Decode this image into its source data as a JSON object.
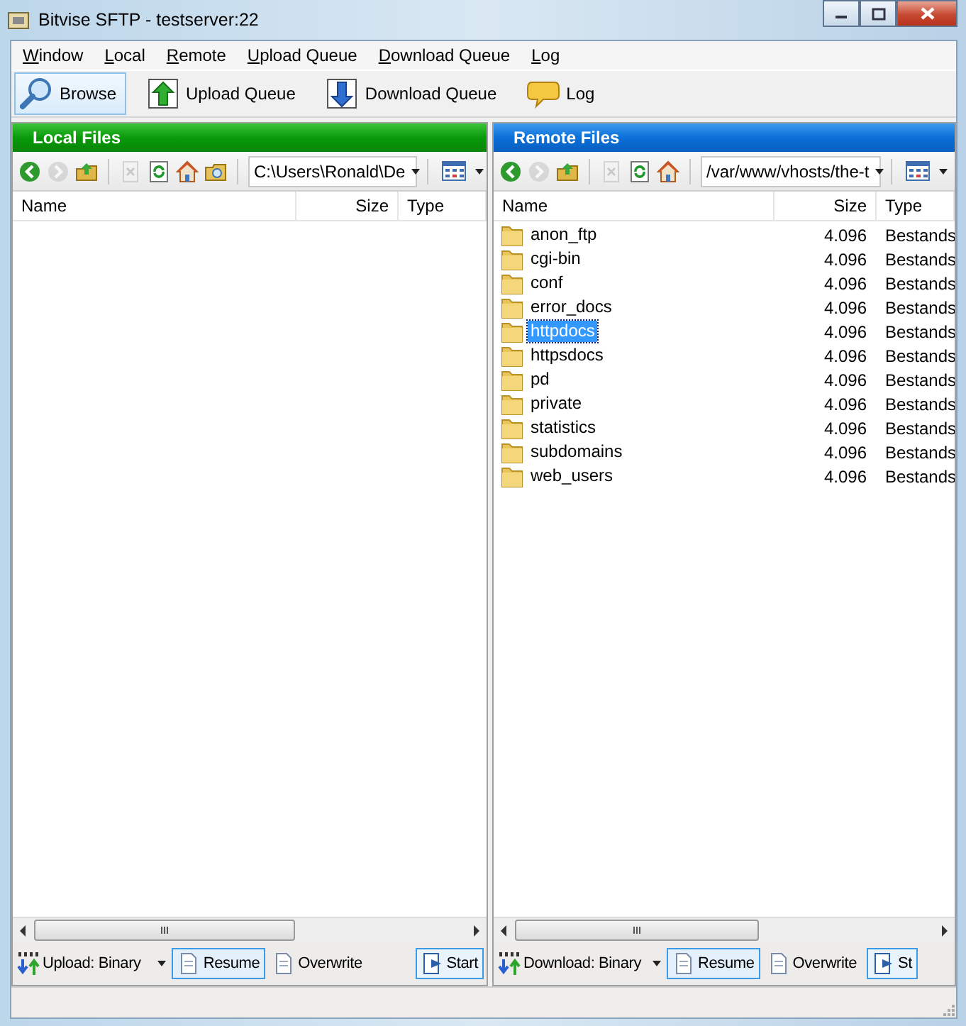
{
  "window": {
    "title": "Bitvise SFTP - testserver:22"
  },
  "menu": [
    "Window",
    "Local",
    "Remote",
    "Upload Queue",
    "Download Queue",
    "Log"
  ],
  "toolbar": [
    {
      "kind": "browse",
      "label": "Browse",
      "selected": true
    },
    {
      "kind": "upload",
      "label": "Upload Queue",
      "selected": false
    },
    {
      "kind": "download",
      "label": "Download Queue",
      "selected": false
    },
    {
      "kind": "log",
      "label": "Log",
      "selected": false
    }
  ],
  "panes": [
    {
      "kind": "local",
      "title": "Local Files",
      "path": "C:\\Users\\Ronald\\De",
      "nav_icons": [
        {
          "kind": "back",
          "disabled": false
        },
        {
          "kind": "forward",
          "disabled": true
        },
        {
          "kind": "up",
          "disabled": false
        },
        {
          "kind": "delete",
          "disabled": true
        },
        {
          "kind": "refresh",
          "disabled": false
        },
        {
          "kind": "home",
          "disabled": false
        },
        {
          "kind": "folder",
          "disabled": false
        }
      ],
      "columns": [
        "Name",
        "Size",
        "Type"
      ],
      "transfer_mode": "Upload: Binary",
      "buttons": [
        {
          "kind": "option",
          "label": "Resume",
          "selected": true
        },
        {
          "kind": "option",
          "label": "Overwrite",
          "selected": false
        },
        {
          "kind": "action",
          "label": "Start"
        }
      ]
    },
    {
      "kind": "remote",
      "title": "Remote Files",
      "path": "/var/www/vhosts/the-t",
      "nav_icons": [
        {
          "kind": "back",
          "disabled": false
        },
        {
          "kind": "forward",
          "disabled": true
        },
        {
          "kind": "up",
          "disabled": false
        },
        {
          "kind": "delete",
          "disabled": true
        },
        {
          "kind": "refresh",
          "disabled": false
        },
        {
          "kind": "home",
          "disabled": false
        }
      ],
      "columns": [
        "Name",
        "Size",
        "Type"
      ],
      "rows": [
        {
          "name": "anon_ftp",
          "size": "4.096",
          "type": "Bestands",
          "selected": false
        },
        {
          "name": "cgi-bin",
          "size": "4.096",
          "type": "Bestands",
          "selected": false
        },
        {
          "name": "conf",
          "size": "4.096",
          "type": "Bestands",
          "selected": false
        },
        {
          "name": "error_docs",
          "size": "4.096",
          "type": "Bestands",
          "selected": false
        },
        {
          "name": "httpdocs",
          "size": "4.096",
          "type": "Bestands",
          "selected": true
        },
        {
          "name": "httpsdocs",
          "size": "4.096",
          "type": "Bestands",
          "selected": false
        },
        {
          "name": "pd",
          "size": "4.096",
          "type": "Bestands",
          "selected": false
        },
        {
          "name": "private",
          "size": "4.096",
          "type": "Bestands",
          "selected": false
        },
        {
          "name": "statistics",
          "size": "4.096",
          "type": "Bestands",
          "selected": false
        },
        {
          "name": "subdomains",
          "size": "4.096",
          "type": "Bestands",
          "selected": false
        },
        {
          "name": "web_users",
          "size": "4.096",
          "type": "Bestands",
          "selected": false
        }
      ],
      "transfer_mode": "Download: Binary",
      "buttons": [
        {
          "kind": "option",
          "label": "Resume",
          "selected": true
        },
        {
          "kind": "option",
          "label": "Overwrite",
          "selected": false
        },
        {
          "kind": "action",
          "label": "St"
        }
      ]
    }
  ]
}
